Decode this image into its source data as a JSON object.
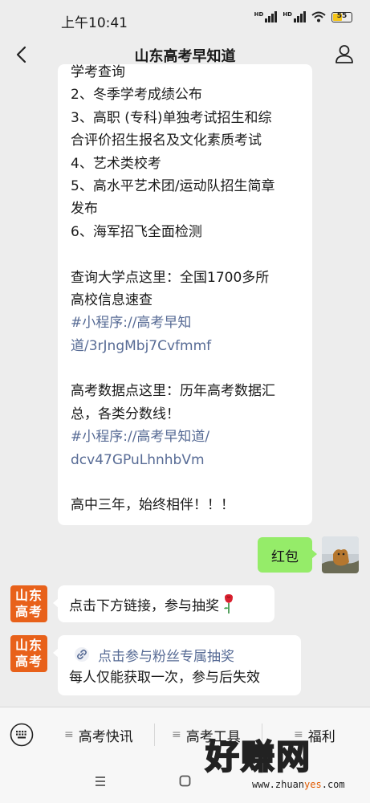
{
  "status_bar": {
    "time": "上午10:41",
    "signal1_label": "HD",
    "signal2_label": "HD",
    "battery": "55",
    "battery_color": "#f5c518"
  },
  "nav": {
    "title": "山东高考早知道",
    "back_icon": "chevron-left-icon",
    "profile_icon": "person-icon"
  },
  "messages": {
    "main": {
      "lines": [
        "学考查询",
        "2、冬季学考成绩公布",
        "3、高职 (专科)单独考试招生和综",
        "合评价招生报名及文化素质考试",
        "4、艺术类校考",
        "5、高水平艺术团/运动队招生简章",
        "发布",
        "6、海军招飞全面检测",
        "",
        "查询大学点这里：全国1700多所",
        "高校信息速查",
        "#小程序://高考早知",
        "道/3rJngMbj7Cvfmmf",
        "",
        "高考数据点这里：历年高考数据汇",
        "总，各类分数线！",
        "#小程序://高考早知道/",
        "dcv47GPuLhnhbVm",
        "",
        "高中三年，始终相伴！！！"
      ]
    },
    "self_red_packet": {
      "text": "红包"
    },
    "lottery": {
      "avatar_text_1": "山东",
      "avatar_text_2": "高考",
      "text": "点击下方链接，参与抽奖"
    },
    "link_card": {
      "avatar_text_1": "山东",
      "avatar_text_2": "高考",
      "link_text": "点击参与粉丝专属抽奖",
      "desc": "每人仅能获取一次，参与后失效"
    }
  },
  "menu": {
    "items": [
      "高考快讯",
      "高考工具",
      "福利"
    ],
    "hamburger": "≡"
  },
  "watermark": {
    "brand": "好赚网",
    "url_a": "www.zhuan",
    "url_b": "yes",
    "url_c": ".com"
  }
}
